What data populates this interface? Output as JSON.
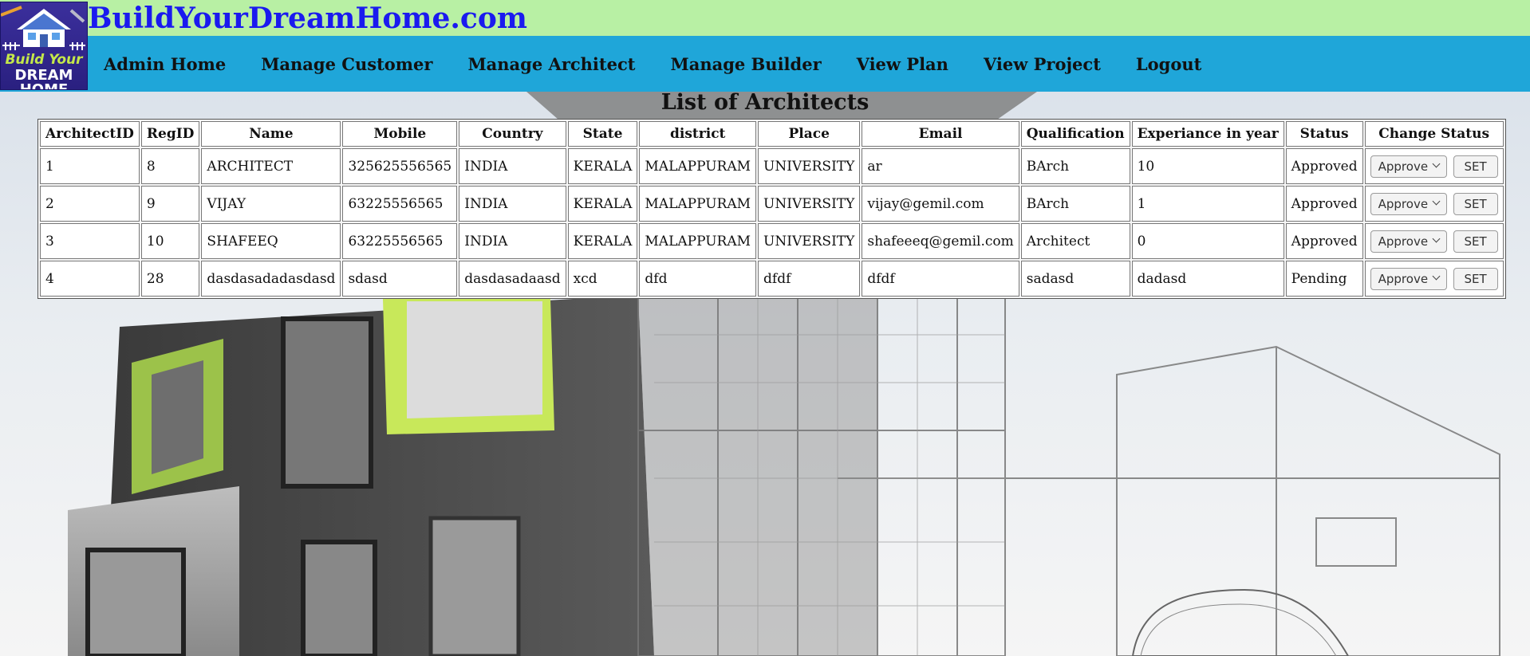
{
  "header": {
    "site_title": "BuildYourDreamHome.com",
    "logo": {
      "line1": "Build Your",
      "line2": "DREAM HOME"
    },
    "colors": {
      "topbar": "#b8f0a4",
      "navbar": "#1fa6d9",
      "title": "#1a1aef"
    }
  },
  "nav": {
    "items": [
      {
        "label": "Admin Home"
      },
      {
        "label": "Manage Customer"
      },
      {
        "label": "Manage Architect"
      },
      {
        "label": "Manage Builder"
      },
      {
        "label": "View Plan"
      },
      {
        "label": "View Project"
      },
      {
        "label": "Logout"
      }
    ]
  },
  "main": {
    "heading": "List of Architects",
    "table": {
      "columns": [
        "ArchitectID",
        "RegID",
        "Name",
        "Mobile",
        "Country",
        "State",
        "district",
        "Place",
        "Email",
        "Qualification",
        "Experiance in year",
        "Status",
        "Change Status"
      ],
      "rows": [
        {
          "id": "1",
          "regid": "8",
          "name": "ARCHITECT",
          "mobile": "325625556565",
          "country": "INDIA",
          "state": "KERALA",
          "district": "MALAPPURAM",
          "place": "UNIVERSITY",
          "email": "ar",
          "qualification": "BArch",
          "experience": "10",
          "status": "Approved",
          "select_value": "Approve",
          "set_label": "SET"
        },
        {
          "id": "2",
          "regid": "9",
          "name": "VIJAY",
          "mobile": "63225556565",
          "country": "INDIA",
          "state": "KERALA",
          "district": "MALAPPURAM",
          "place": "UNIVERSITY",
          "email": "vijay@gemil.com",
          "qualification": "BArch",
          "experience": "1",
          "status": "Approved",
          "select_value": "Approve",
          "set_label": "SET"
        },
        {
          "id": "3",
          "regid": "10",
          "name": "SHAFEEQ",
          "mobile": "63225556565",
          "country": "INDIA",
          "state": "KERALA",
          "district": "MALAPPURAM",
          "place": "UNIVERSITY",
          "email": "shafeeeq@gemil.com",
          "qualification": "Architect",
          "experience": "0",
          "status": "Approved",
          "select_value": "Approve",
          "set_label": "SET"
        },
        {
          "id": "4",
          "regid": "28",
          "name": "dasdasadadasdasd",
          "mobile": "sdasd",
          "country": "dasdasadaasd",
          "state": "xcd",
          "district": "dfd",
          "place": "dfdf",
          "email": "dfdf",
          "qualification": "sadasd",
          "experience": "dadasd",
          "status": "Pending",
          "select_value": "Approve",
          "set_label": "SET"
        }
      ]
    }
  }
}
